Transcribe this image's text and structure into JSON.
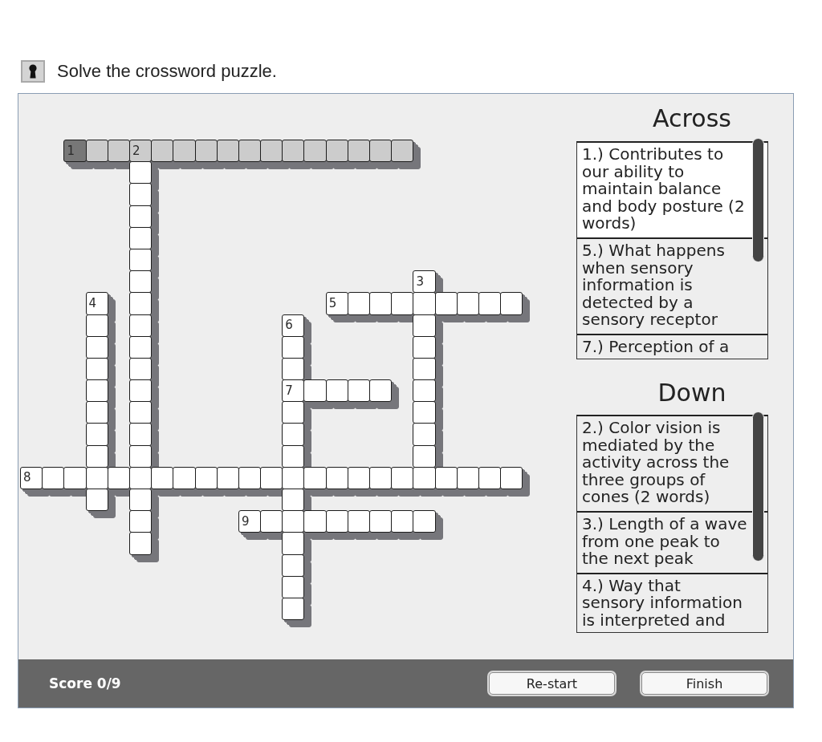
{
  "instruction": {
    "text": "Solve the crossword puzzle."
  },
  "grid": {
    "rows": [
      [
        null,
        null,
        {
          "number": "1",
          "selected": true,
          "highlighted": true
        },
        {
          "selected": false,
          "highlighted": true
        },
        {
          "selected": false,
          "highlighted": true
        },
        {
          "number": "2",
          "selected": false,
          "highlighted": true
        },
        {
          "selected": false,
          "highlighted": true
        },
        {
          "selected": false,
          "highlighted": true
        },
        {
          "selected": false,
          "highlighted": true
        },
        {
          "selected": false,
          "highlighted": true
        },
        {
          "selected": false,
          "highlighted": true
        },
        {
          "selected": false,
          "highlighted": true
        },
        {
          "selected": false,
          "highlighted": true
        },
        {
          "selected": false,
          "highlighted": true
        },
        {
          "selected": false,
          "highlighted": true
        },
        {
          "selected": false,
          "highlighted": true
        },
        {
          "selected": false,
          "highlighted": true
        },
        {
          "selected": false,
          "highlighted": true
        }
      ],
      [
        null,
        null,
        null,
        null,
        null,
        {
          "selected": false,
          "highlighted": false
        }
      ],
      [
        null,
        null,
        null,
        null,
        null,
        {
          "selected": false,
          "highlighted": false
        }
      ],
      [
        null,
        null,
        null,
        null,
        null,
        {
          "selected": false,
          "highlighted": false
        }
      ],
      [
        null,
        null,
        null,
        null,
        null,
        {
          "selected": false,
          "highlighted": false
        }
      ],
      [
        null,
        null,
        null,
        null,
        null,
        {
          "selected": false,
          "highlighted": false
        }
      ],
      [
        null,
        null,
        null,
        null,
        null,
        {
          "selected": false,
          "highlighted": false
        },
        null,
        null,
        null,
        null,
        null,
        null,
        null,
        null,
        null,
        null,
        null,
        null,
        {
          "number": "3",
          "selected": false,
          "highlighted": false
        }
      ],
      [
        null,
        null,
        null,
        {
          "number": "4",
          "selected": false,
          "highlighted": false
        },
        null,
        {
          "selected": false,
          "highlighted": false
        },
        null,
        null,
        null,
        null,
        null,
        null,
        null,
        null,
        {
          "number": "5",
          "selected": false,
          "highlighted": false
        },
        {
          "selected": false,
          "highlighted": false
        },
        {
          "selected": false,
          "highlighted": false
        },
        {
          "selected": false,
          "highlighted": false
        },
        {
          "selected": false,
          "highlighted": false
        },
        {
          "selected": false,
          "highlighted": false
        },
        {
          "selected": false,
          "highlighted": false
        },
        {
          "selected": false,
          "highlighted": false
        },
        {
          "selected": false,
          "highlighted": false
        }
      ],
      [
        null,
        null,
        null,
        {
          "selected": false,
          "highlighted": false
        },
        null,
        {
          "selected": false,
          "highlighted": false
        },
        null,
        null,
        null,
        null,
        null,
        null,
        {
          "number": "6",
          "selected": false,
          "highlighted": false
        },
        null,
        null,
        null,
        null,
        null,
        {
          "selected": false,
          "highlighted": false
        }
      ],
      [
        null,
        null,
        null,
        {
          "selected": false,
          "highlighted": false
        },
        null,
        {
          "selected": false,
          "highlighted": false
        },
        null,
        null,
        null,
        null,
        null,
        null,
        {
          "selected": false,
          "highlighted": false
        },
        null,
        null,
        null,
        null,
        null,
        {
          "selected": false,
          "highlighted": false
        }
      ],
      [
        null,
        null,
        null,
        {
          "selected": false,
          "highlighted": false
        },
        null,
        {
          "selected": false,
          "highlighted": false
        },
        null,
        null,
        null,
        null,
        null,
        null,
        {
          "selected": false,
          "highlighted": false
        },
        null,
        null,
        null,
        null,
        null,
        {
          "selected": false,
          "highlighted": false
        }
      ],
      [
        null,
        null,
        null,
        {
          "selected": false,
          "highlighted": false
        },
        null,
        {
          "selected": false,
          "highlighted": false
        },
        null,
        null,
        null,
        null,
        null,
        null,
        {
          "number": "7",
          "selected": false,
          "highlighted": false
        },
        {
          "selected": false,
          "highlighted": false
        },
        {
          "selected": false,
          "highlighted": false
        },
        {
          "selected": false,
          "highlighted": false
        },
        {
          "selected": false,
          "highlighted": false
        },
        null,
        {
          "selected": false,
          "highlighted": false
        }
      ],
      [
        null,
        null,
        null,
        {
          "selected": false,
          "highlighted": false
        },
        null,
        {
          "selected": false,
          "highlighted": false
        },
        null,
        null,
        null,
        null,
        null,
        null,
        {
          "selected": false,
          "highlighted": false
        },
        null,
        null,
        null,
        null,
        null,
        {
          "selected": false,
          "highlighted": false
        }
      ],
      [
        null,
        null,
        null,
        {
          "selected": false,
          "highlighted": false
        },
        null,
        {
          "selected": false,
          "highlighted": false
        },
        null,
        null,
        null,
        null,
        null,
        null,
        {
          "selected": false,
          "highlighted": false
        },
        null,
        null,
        null,
        null,
        null,
        {
          "selected": false,
          "highlighted": false
        }
      ],
      [
        null,
        null,
        null,
        {
          "selected": false,
          "highlighted": false
        },
        null,
        {
          "selected": false,
          "highlighted": false
        },
        null,
        null,
        null,
        null,
        null,
        null,
        {
          "selected": false,
          "highlighted": false
        },
        null,
        null,
        null,
        null,
        null,
        {
          "selected": false,
          "highlighted": false
        }
      ],
      [
        {
          "number": "8",
          "selected": false,
          "highlighted": false
        },
        {
          "selected": false,
          "highlighted": false
        },
        {
          "selected": false,
          "highlighted": false
        },
        {
          "selected": false,
          "highlighted": false
        },
        {
          "selected": false,
          "highlighted": false
        },
        {
          "selected": false,
          "highlighted": false
        },
        {
          "selected": false,
          "highlighted": false
        },
        {
          "selected": false,
          "highlighted": false
        },
        {
          "selected": false,
          "highlighted": false
        },
        {
          "selected": false,
          "highlighted": false
        },
        {
          "selected": false,
          "highlighted": false
        },
        {
          "selected": false,
          "highlighted": false
        },
        {
          "selected": false,
          "highlighted": false
        },
        {
          "selected": false,
          "highlighted": false
        },
        {
          "selected": false,
          "highlighted": false
        },
        {
          "selected": false,
          "highlighted": false
        },
        {
          "selected": false,
          "highlighted": false
        },
        {
          "selected": false,
          "highlighted": false
        },
        {
          "selected": false,
          "highlighted": false
        },
        {
          "selected": false,
          "highlighted": false
        },
        {
          "selected": false,
          "highlighted": false
        },
        {
          "selected": false,
          "highlighted": false
        },
        {
          "selected": false,
          "highlighted": false
        }
      ],
      [
        null,
        null,
        null,
        {
          "selected": false,
          "highlighted": false
        },
        null,
        {
          "selected": false,
          "highlighted": false
        },
        null,
        null,
        null,
        null,
        null,
        null,
        {
          "selected": false,
          "highlighted": false
        }
      ],
      [
        null,
        null,
        null,
        null,
        null,
        {
          "selected": false,
          "highlighted": false
        },
        null,
        null,
        null,
        null,
        {
          "number": "9",
          "selected": false,
          "highlighted": false
        },
        {
          "selected": false,
          "highlighted": false
        },
        {
          "selected": false,
          "highlighted": false
        },
        {
          "selected": false,
          "highlighted": false
        },
        {
          "selected": false,
          "highlighted": false
        },
        {
          "selected": false,
          "highlighted": false
        },
        {
          "selected": false,
          "highlighted": false
        },
        {
          "selected": false,
          "highlighted": false
        },
        {
          "selected": false,
          "highlighted": false
        }
      ],
      [
        null,
        null,
        null,
        null,
        null,
        {
          "selected": false,
          "highlighted": false
        },
        null,
        null,
        null,
        null,
        null,
        null,
        {
          "selected": false,
          "highlighted": false
        }
      ],
      [
        null,
        null,
        null,
        null,
        null,
        null,
        null,
        null,
        null,
        null,
        null,
        null,
        {
          "selected": false,
          "highlighted": false
        }
      ],
      [
        null,
        null,
        null,
        null,
        null,
        null,
        null,
        null,
        null,
        null,
        null,
        null,
        {
          "selected": false,
          "highlighted": false
        }
      ],
      [
        null,
        null,
        null,
        null,
        null,
        null,
        null,
        null,
        null,
        null,
        null,
        null,
        {
          "selected": false,
          "highlighted": false
        }
      ]
    ]
  },
  "clues": [
    {
      "title": "Across",
      "items": [
        {
          "text": "1.) Contributes to our ability to maintain balance and body posture (2 words)",
          "selected": true
        },
        {
          "text": "5.) What happens when sensory information is detected by a sensory receptor",
          "selected": false
        },
        {
          "text": "7.) Perception of a",
          "selected": false
        }
      ]
    },
    {
      "title": "Down",
      "items": [
        {
          "text": "2.) Color vision is mediated by the activity across the three groups of cones (2 words)",
          "selected": false
        },
        {
          "text": "3.) Length of a wave from one peak to the next peak",
          "selected": false
        },
        {
          "text": "4.) Way that sensory information is interpreted and",
          "selected": false
        }
      ]
    }
  ],
  "footer": {
    "score": "Score 0/9",
    "buttons": [
      {
        "label": "Re-start"
      },
      {
        "label": "Finish"
      }
    ]
  }
}
